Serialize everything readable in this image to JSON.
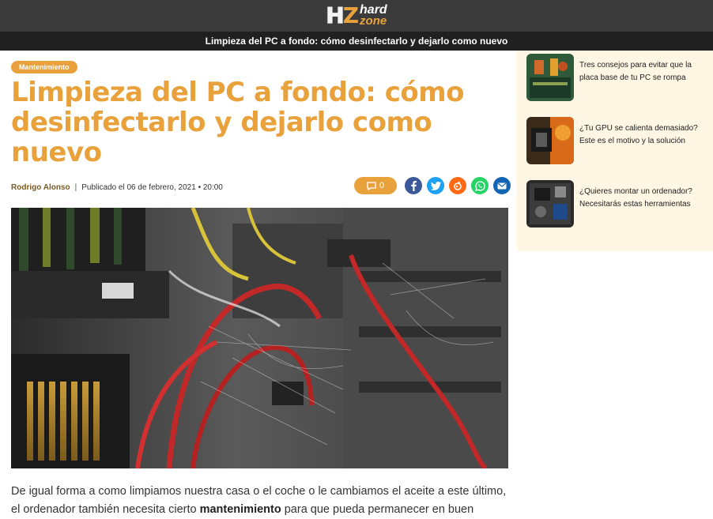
{
  "header": {
    "logo_hard": "hard",
    "logo_zone": "zone",
    "article_title_bar": "Limpieza del PC a fondo: cómo desinfectarlo y dejarlo como nuevo"
  },
  "article": {
    "category": "Mantenimiento",
    "headline": "Limpieza del PC a fondo: cómo desinfectarlo y dejarlo como nuevo",
    "author": "Rodrigo Alonso",
    "separator": "|",
    "published": "Publicado el 06 de febrero, 2021 • 20:00",
    "comment_count": "0",
    "share_icons": [
      "facebook-icon",
      "twitter-icon",
      "meneame-icon",
      "whatsapp-icon",
      "email-icon"
    ],
    "hero_image_desc": "Dusty PC interior with red cables and cobwebs",
    "body_part1": "De igual forma a como limpiamos nuestra casa o el coche o le cambiamos el aceite a este último, el ordenador también necesita cierto ",
    "body_bold": "mantenimiento",
    "body_part2": " para que pueda permanecer en buen"
  },
  "sidebar": {
    "items": [
      {
        "title": "Tres consejos para evitar que la placa base de tu PC se rompa"
      },
      {
        "title": "¿Tu GPU se calienta demasiado? Este es el motivo y la solución"
      },
      {
        "title": "¿Quieres montar un ordenador? Necesitarás estas herramientas"
      }
    ]
  },
  "colors": {
    "accent": "#e9a23b",
    "topbar": "#3b3b3b",
    "titlebar": "#202020",
    "sidebar_bg": "#fff6e4"
  }
}
